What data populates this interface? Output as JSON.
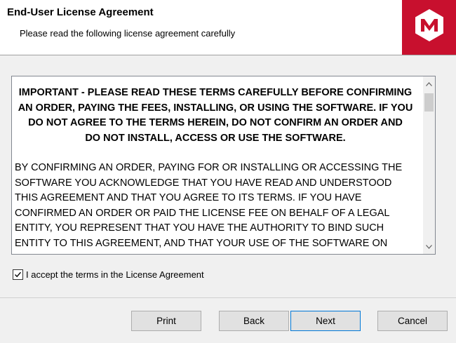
{
  "header": {
    "title": "End-User License Agreement",
    "subtitle": "Please read the following license agreement carefully",
    "logo_icon": "m-logo-icon",
    "brand_color": "#c8102e"
  },
  "license": {
    "important_lines": [
      "IMPORTANT - PLEASE READ THESE TERMS CAREFULLY BEFORE CONFIRMING",
      "AN ORDER, PAYING THE FEES, INSTALLING, OR USING THE SOFTWARE. IF YOU",
      "DO NOT AGREE TO THE TERMS HEREIN, DO NOT CONFIRM AN ORDER AND",
      "DO NOT INSTALL, ACCESS OR USE THE SOFTWARE."
    ],
    "body_lines": [
      "BY CONFIRMING AN ORDER, PAYING FOR OR INSTALLING OR ACCESSING THE",
      "SOFTWARE YOU ACKNOWLEDGE THAT YOU HAVE READ AND UNDERSTOOD",
      "THIS AGREEMENT AND THAT YOU AGREE TO ITS TERMS. IF YOU HAVE",
      "CONFIRMED AN ORDER OR PAID THE LICENSE FEE ON BEHALF OF A LEGAL",
      "ENTITY, YOU REPRESENT THAT YOU HAVE THE AUTHORITY TO BIND SUCH",
      "ENTITY TO THIS AGREEMENT, AND THAT YOUR USE OF THE SOFTWARE ON"
    ]
  },
  "accept": {
    "label": "I accept the terms in the License Agreement",
    "checked": true
  },
  "buttons": {
    "print": "Print",
    "back": "Back",
    "next": "Next",
    "cancel": "Cancel"
  }
}
